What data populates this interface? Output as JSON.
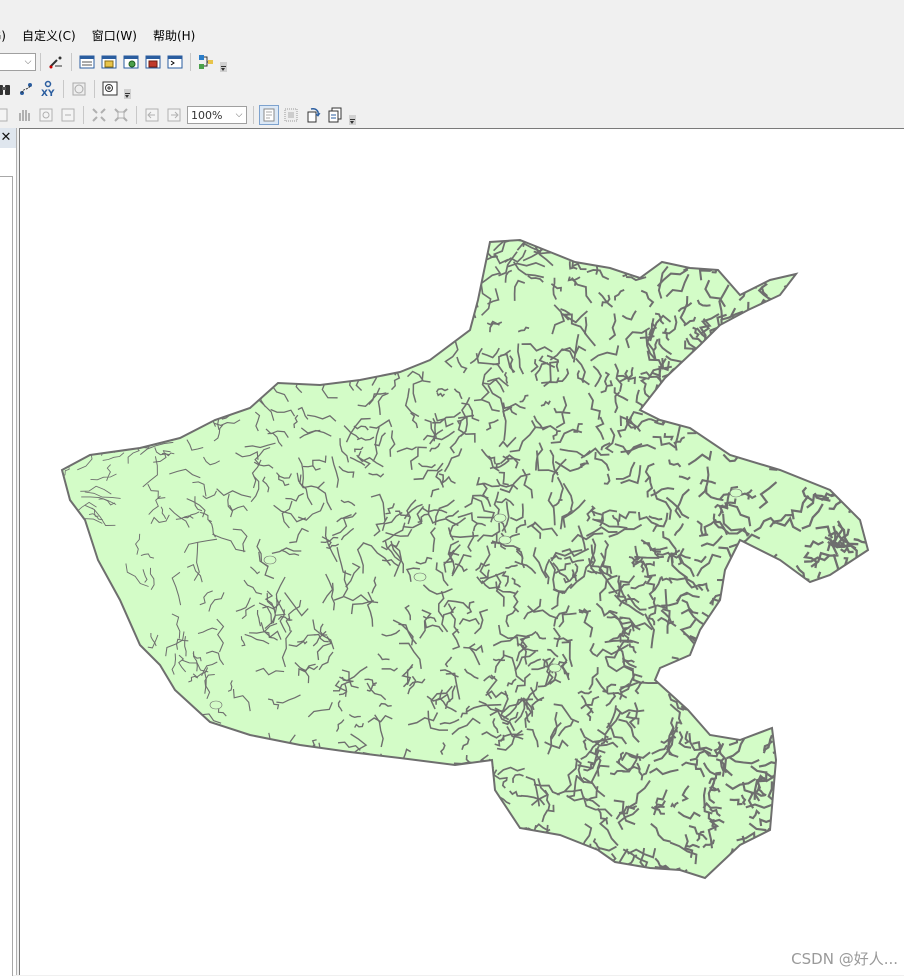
{
  "menubar": {
    "items": [
      {
        "id": "partial",
        "label": "G)"
      },
      {
        "id": "customize",
        "label": "自定义(C)"
      },
      {
        "id": "window",
        "label": "窗口(W)"
      },
      {
        "id": "help",
        "label": "帮助(H)"
      }
    ]
  },
  "layout_toolbar": {
    "zoom_value": "100%"
  },
  "map": {
    "fill_color": "#d3fcc7",
    "line_color": "#6e6e6e",
    "background": "#ffffff"
  },
  "watermark": "CSDN @好人..."
}
